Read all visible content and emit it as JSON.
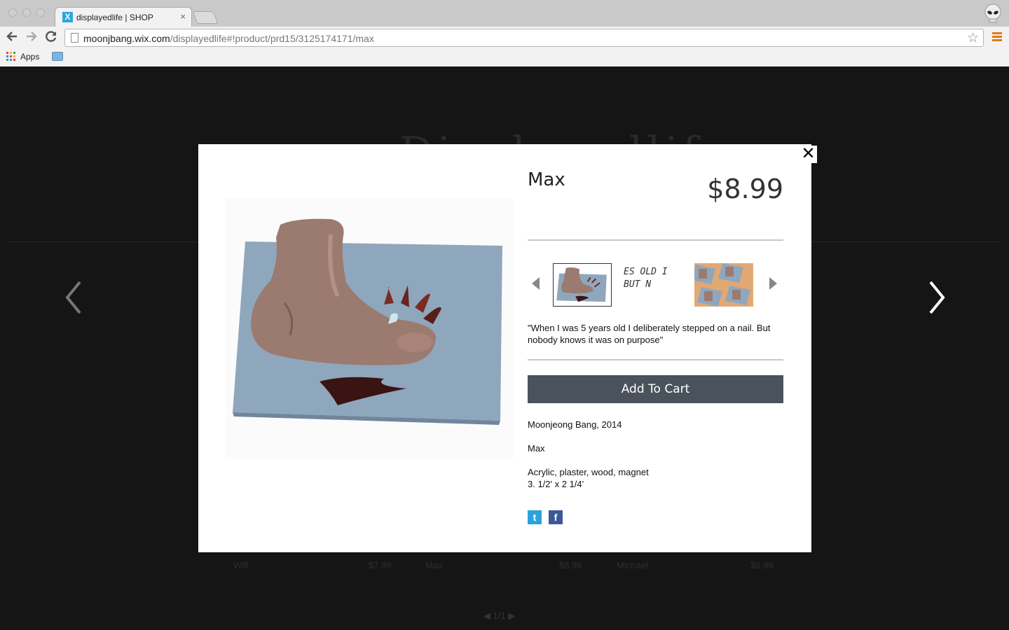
{
  "browser": {
    "tab_title": "displayedlife | SHOP",
    "tab_close": "×",
    "favicon_letter": "X",
    "url_host": "moonjbang.wix.com",
    "url_path": "/displayedlife#!product/prd15/3125174171/max",
    "bookmarks_apps_label": "Apps",
    "icons": [
      "back-icon",
      "forward-icon",
      "reload-icon",
      "star-icon",
      "menu-icon",
      "apps-icon",
      "folder-icon",
      "alien-icon"
    ]
  },
  "background_page": {
    "logo_text": "Displayedlife",
    "grid_row": [
      {
        "name": "Will",
        "price": "$7.99"
      },
      {
        "name": "Max",
        "price": "$8.99"
      },
      {
        "name": "Michael",
        "price": "$6.99"
      }
    ],
    "pager": "◀ 1/1 ▶"
  },
  "product": {
    "name": "Max",
    "price": "$8.99",
    "quote": "\"When I was 5 years old I deliberately stepped on a nail. But nobody knows it was on purpose\"",
    "add_to_cart_label": "Add To Cart",
    "artist_line": "Moonjeong Bang, 2014",
    "title_line": "Max",
    "materials": "Acrylic, plaster, wood, magnet",
    "dimensions": "3. 1/2' x 2 1/4'",
    "thumbnail_2_text_line1": "ES  OLD  I",
    "thumbnail_2_text_line2": "BUT  N",
    "close_label": "✕",
    "social": {
      "twitter": "t",
      "facebook": "f"
    },
    "colors": {
      "button": "#4a535b",
      "twitter": "#2aa3dc",
      "facebook": "#3b5998"
    }
  }
}
